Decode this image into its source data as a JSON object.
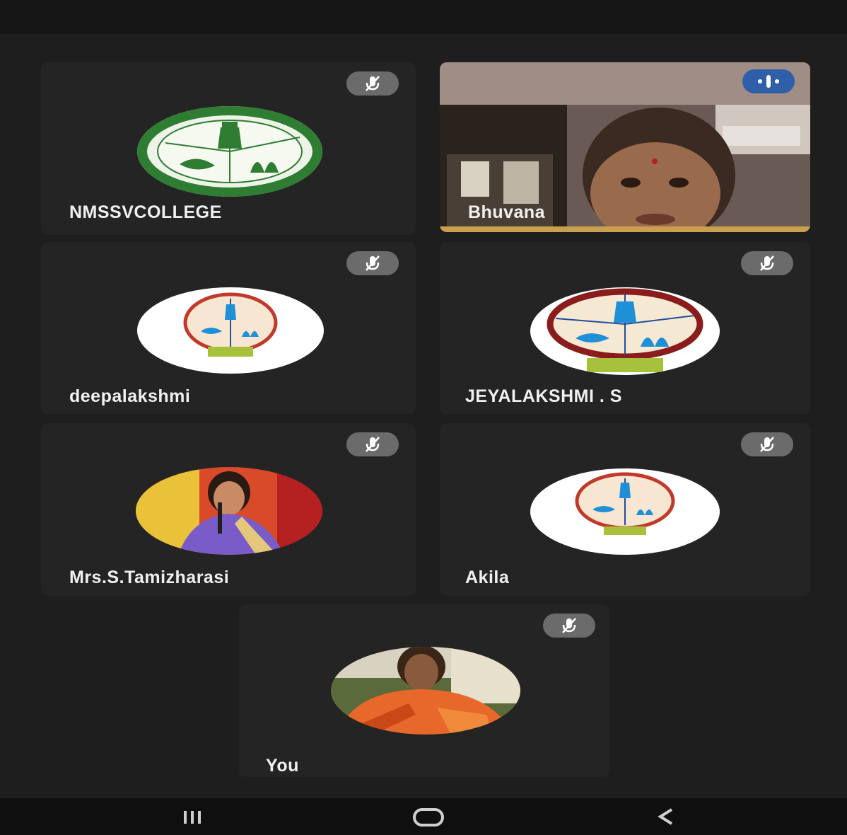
{
  "participants": [
    {
      "label": "NMSSVCOLLEGE",
      "mic": "muted",
      "avatar": "college-logo"
    },
    {
      "label": "Bhuvana",
      "mic": "speaking",
      "avatar": "live-video"
    },
    {
      "label": "deepalakshmi",
      "mic": "muted",
      "avatar": "college-logo-with-faculty-banner"
    },
    {
      "label": "JEYALAKSHMI . S",
      "mic": "muted",
      "avatar": "college-logo-with-faculty-banner"
    },
    {
      "label": "Mrs.S.Tamizharasi",
      "mic": "muted",
      "avatar": "profile-photo"
    },
    {
      "label": "Akila",
      "mic": "muted",
      "avatar": "college-logo-with-faculty-banner"
    },
    {
      "label": "You",
      "mic": "muted",
      "avatar": "profile-photo"
    }
  ],
  "icons": {
    "muted": "mic-off-icon",
    "speaking": "audio-level-icon",
    "recents": "recent-apps-icon",
    "home": "home-icon",
    "back": "back-icon"
  },
  "colors": {
    "background": "#1c1c1c",
    "tile": "#242424",
    "muted_badge": "#6b6b6b",
    "speaking_badge": "#2f5fa8",
    "logo_green": "#2e7d32"
  }
}
